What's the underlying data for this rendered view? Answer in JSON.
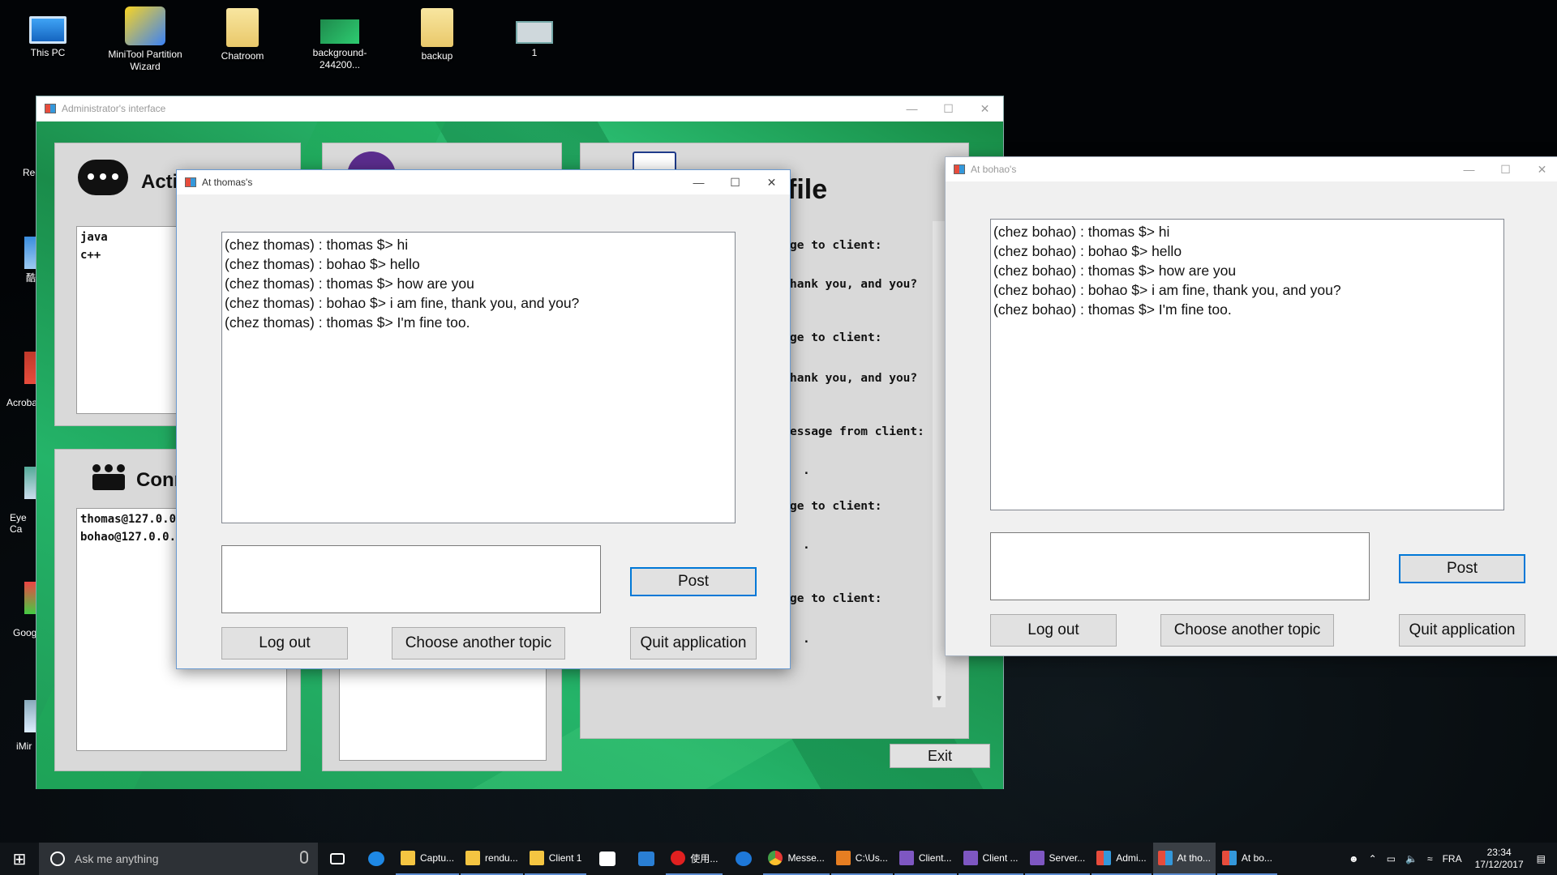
{
  "desktop": {
    "icons": [
      {
        "label": "This PC"
      },
      {
        "label": "MiniTool Partition Wizard"
      },
      {
        "label": "Chatroom"
      },
      {
        "label": "background-244200..."
      },
      {
        "label": "backup"
      },
      {
        "label": "1"
      }
    ],
    "edge_icons": [
      {
        "label": "Rec"
      },
      {
        "label": "酷"
      },
      {
        "label": "Acroba"
      },
      {
        "label": "Eye Ca"
      },
      {
        "label": "Goog"
      },
      {
        "label": "iMir"
      }
    ]
  },
  "admin": {
    "title": "Administrator's interface",
    "panel_topics_heading": "Acti",
    "topics": [
      "java",
      "c++"
    ],
    "panel_connected_heading": "Conne",
    "connected": [
      "thomas@127.0.0",
      "bohao@127.0.0."
    ],
    "profile_heading": "file",
    "log_lines": [
      "ge to client:",
      "hank you, and you?",
      "ge to client:",
      "hank you, and you?",
      "essage from client:",
      ".",
      "ge to client:",
      ".",
      "ge to client:",
      "."
    ],
    "exit_label": "Exit"
  },
  "thomas": {
    "title": "At thomas's",
    "messages": [
      "(chez thomas) : thomas $> hi",
      "(chez thomas) : bohao $> hello",
      "(chez thomas) : thomas $> how are you",
      "(chez thomas) : bohao $> i am fine, thank you, and you?",
      "(chez thomas) : thomas $> I'm fine too."
    ],
    "post_label": "Post",
    "logout_label": "Log out",
    "topic_label": "Choose another topic",
    "quit_label": "Quit application"
  },
  "bohao": {
    "title": "At bohao's",
    "messages": [
      "(chez bohao) : thomas $> hi",
      "(chez bohao) : bohao $> hello",
      "(chez bohao) : thomas $> how are you",
      "(chez bohao) : bohao $> i am fine, thank you, and you?",
      "(chez bohao) : thomas $> I'm fine too."
    ],
    "post_label": "Post",
    "logout_label": "Log out",
    "topic_label": "Choose another topic",
    "quit_label": "Quit application"
  },
  "taskbar": {
    "search_placeholder": "Ask me anything",
    "items": [
      {
        "label": "Captu..."
      },
      {
        "label": "rendu..."
      },
      {
        "label": "Client 1"
      },
      {
        "label": "使用..."
      },
      {
        "label": "Messe..."
      },
      {
        "label": "C:\\Us..."
      },
      {
        "label": "Client..."
      },
      {
        "label": "Client ..."
      },
      {
        "label": "Server..."
      },
      {
        "label": "Admi..."
      },
      {
        "label": "At tho..."
      },
      {
        "label": "At bo..."
      }
    ],
    "language": "FRA",
    "time": "23:34",
    "date": "17/12/2017"
  }
}
